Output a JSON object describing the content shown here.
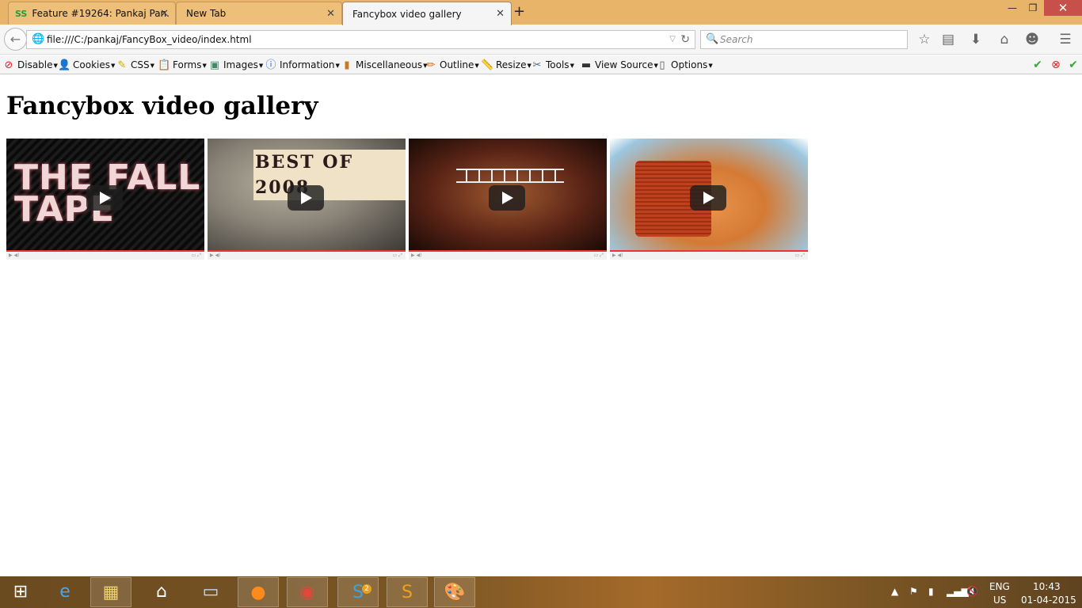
{
  "browser": {
    "tabs": [
      {
        "label": "Feature #19264: Pankaj Pan...",
        "favicon": "SS",
        "close": "✕"
      },
      {
        "label": "New Tab",
        "close": "✕"
      },
      {
        "label": "Fancybox video gallery",
        "close": "✕",
        "active": true
      }
    ],
    "new_tab": "+",
    "window_controls": {
      "minimize": "—",
      "maximize": "❐",
      "close": "✕"
    },
    "url": "file:///C:/pankaj/FancyBox_video/index.html",
    "search_placeholder": "Search",
    "toolbar_icons": [
      "star-icon",
      "reading-list-icon",
      "download-icon",
      "home-icon",
      "hello-icon",
      "menu-icon"
    ]
  },
  "webdev_toolbar": {
    "items": [
      "Disable",
      "Cookies",
      "CSS",
      "Forms",
      "Images",
      "Information",
      "Miscellaneous",
      "Outline",
      "Resize",
      "Tools",
      "View Source",
      "Options"
    ],
    "status_icons": [
      "check-icon",
      "error-icon",
      "check-icon"
    ]
  },
  "page": {
    "title": "Fancybox video gallery",
    "videos": [
      {
        "thumbnail_text": "THE FALL TAPE"
      },
      {
        "thumbnail_text": "BEST OF 2008"
      },
      {
        "thumbnail_text": ""
      },
      {
        "thumbnail_text": ""
      }
    ]
  },
  "taskbar": {
    "apps": [
      "windows-start-icon",
      "internet-explorer-icon",
      "file-explorer-icon",
      "home-icon",
      "lenovo-icon",
      "firefox-icon",
      "chrome-icon",
      "skype-icon",
      "sublime-text-icon",
      "paint-icon"
    ],
    "skype_badge": "2",
    "language_line1": "ENG",
    "language_line2": "US",
    "time": "10:43",
    "date": "01-04-2015"
  },
  "colors": {
    "titlebar": "#e8b46a",
    "close_button": "#c7504b",
    "toolbar_bg": "#f5f5f5"
  }
}
